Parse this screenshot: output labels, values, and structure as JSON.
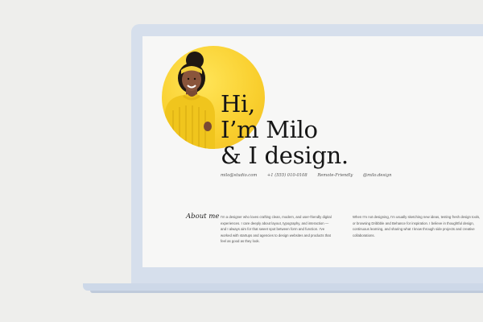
{
  "hero": {
    "line1": "Hi,",
    "line2": "I’m Milo",
    "line3": "& I design."
  },
  "contacts": [
    "milo@studio.com",
    "+1 (555) 010-0108",
    "Remote-Friendly",
    "@milo.design"
  ],
  "about": {
    "heading": "About me",
    "col1": "I'm a designer who loves crafting clean, modern, and user-friendly digital experiences. I care deeply about layout, typography, and interaction — and I always aim for that sweet spot between form and function. I've worked with startups and agencies to design websites and products that feel as good as they look.",
    "col2": "When I'm not designing, I'm usually sketching new ideas, testing fresh design tools, or browsing Dribbble and Behance for inspiration. I believe in thoughtful design, continuous learning, and sharing what I know through side projects and creative collaborations."
  },
  "colors": {
    "page_bg": "#eeeeec",
    "laptop_frame": "#d6dfec",
    "screen_bg": "#f7f7f6",
    "portrait_yellow": "#f9cf2e",
    "sweater_yellow": "#f0c51d",
    "text_dark": "#161616"
  }
}
